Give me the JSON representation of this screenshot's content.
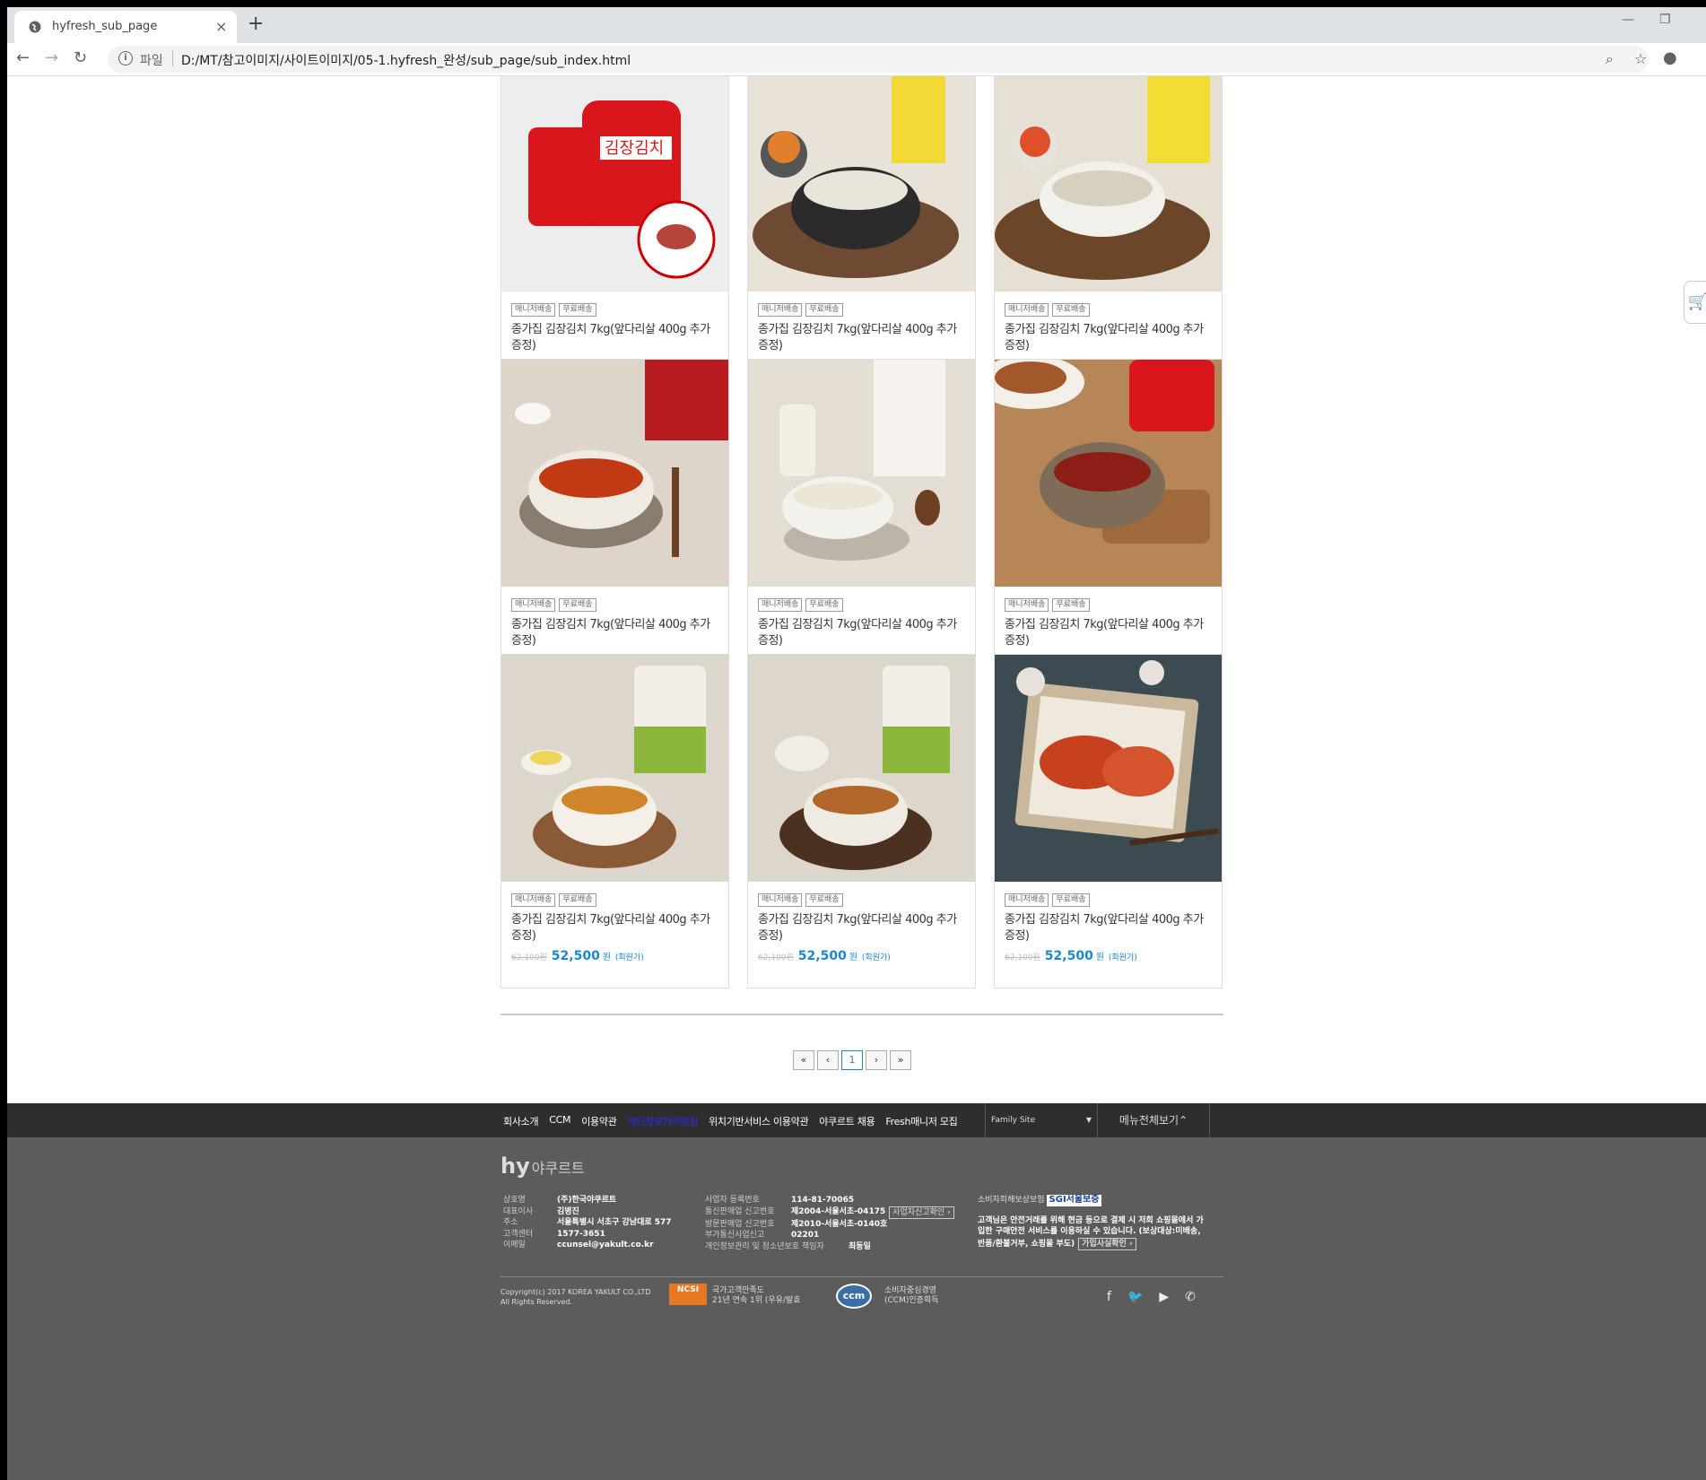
{
  "browser": {
    "tab_title": "hyfresh_sub_page",
    "new_tab": "+",
    "scheme_label": "파일",
    "url": "D:/MT/참고이미지/사이트이미지/05-1.hyfresh_완성/sub_page/sub_index.html"
  },
  "product": {
    "tag1": "매니저배송",
    "tag2": "무료배송",
    "name": "종가집 김장김치 7kg(앞다리살 400g 추가증정)",
    "old_price": "62,100원",
    "price": "52,500",
    "won": "원",
    "note": "(회원가)"
  },
  "products": [
    {
      "image": "kimchi-package"
    },
    {
      "image": "gomtang-soup"
    },
    {
      "image": "bone-soup"
    },
    {
      "image": "yukgaejang"
    },
    {
      "image": "milky-broth"
    },
    {
      "image": "gochujang"
    },
    {
      "image": "kimchi-stew"
    },
    {
      "image": "beef-stew"
    },
    {
      "image": "kimchi-plate"
    }
  ],
  "pager": {
    "first": "«",
    "prev": "‹",
    "current": "1",
    "next": "›",
    "last": "»"
  },
  "footer": {
    "links": [
      "회사소개",
      "CCM",
      "이용약관",
      "개인정보처리방침",
      "위치기반서비스 이용약관",
      "야쿠르트 채용",
      "Fresh매니저 모집"
    ],
    "family_site": "Family Site",
    "all_menu": "메뉴전체보기",
    "logo": "hy",
    "logo_sub": "야쿠르트",
    "company": [
      {
        "k": "상호명",
        "v": "(주)한국야쿠르트"
      },
      {
        "k": "대표이사",
        "v": "김병진"
      },
      {
        "k": "주소",
        "v": "서울특별시 서초구 강남대로 577"
      },
      {
        "k": "고객센터",
        "v": "1577-3651"
      },
      {
        "k": "이메일",
        "v": "ccunsel@yakult.co.kr"
      }
    ],
    "business": [
      {
        "k": "사업자 등록번호",
        "v": "114-81-70065"
      },
      {
        "k": "통신판매업 신고번호",
        "v": "제2004-서울서초-04175"
      },
      {
        "k": "방문판매업 신고번호",
        "v": "제2010-서울서초-0140호"
      },
      {
        "k": "부가통신사업신고",
        "v": "02201"
      },
      {
        "k": "개인정보관리 및 청소년보호 책임자",
        "v": "최동일"
      }
    ],
    "biz_check": "사업자신고확인",
    "insurance_label": "소비자피해보상보험",
    "insurance_brand": "SGI서울보증",
    "insurance_text": "고객님은 안전거래를 위해 현금 등으로 결제 시 저희 쇼핑몰에서 가입한 구매안전 서비스를 이용하실 수 있습니다. (보상대상:미배송, 반품/환불거부, 쇼핑몰 부도)",
    "insurance_check": "가입사실확인",
    "copyright1": "Copyright(c) 2017 KOREA YAKULT CO.,LTD",
    "copyright2": "All Rights Reserved.",
    "ncsi_logo": "NCSI",
    "ncsi1": "국가고객만족도",
    "ncsi2": "21년 연속 1위 (우유/발효",
    "ccm_logo": "ccm",
    "ccm1": "소비자중심경영",
    "ccm2": "(CCM)인증획득"
  },
  "colors": {
    "accent": "#1b88c9",
    "footer_dark": "#2e2e2e",
    "footer_gray": "#5c5c5c"
  }
}
